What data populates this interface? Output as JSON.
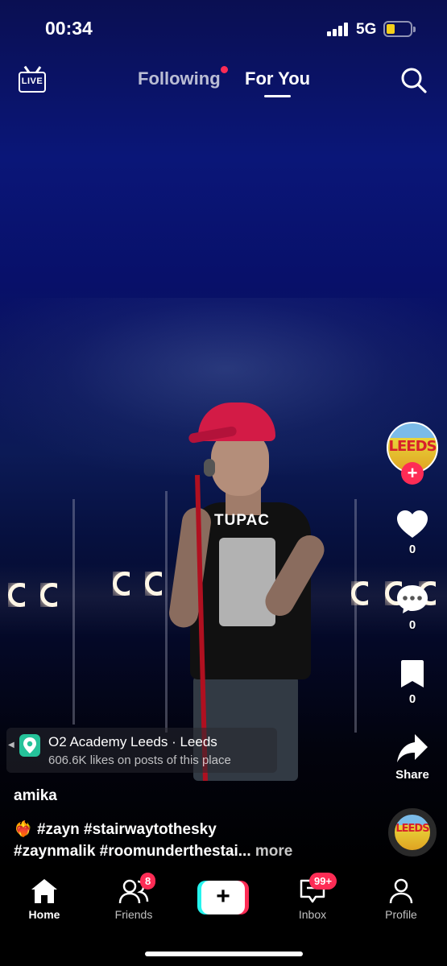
{
  "status_bar": {
    "time": "00:34",
    "network": "5G",
    "battery_level": 0.35
  },
  "top_nav": {
    "live_label": "LIVE",
    "tabs": [
      {
        "label": "Following",
        "active": false,
        "has_dot": true
      },
      {
        "label": "For You",
        "active": true
      }
    ]
  },
  "video": {
    "shirt_text": "TUPAC"
  },
  "actions": {
    "creator_avatar_text": "LEEDS",
    "likes": "0",
    "comments": "0",
    "saves": "0",
    "share_label": "Share"
  },
  "location": {
    "name": "O2 Academy Leeds · Leeds",
    "likes_text": "606.6K likes on posts of this place"
  },
  "post": {
    "username": "amika",
    "caption_emoji": "❤️‍🔥",
    "caption_line1": "#zayn #stairwaytothesky",
    "caption_line2": "#zaynmalik #roomunderthestai...",
    "more_label": "more",
    "sound_disc_text": "LEEDS"
  },
  "bottom_nav": {
    "items": [
      {
        "label": "Home",
        "icon": "home-icon",
        "active": true
      },
      {
        "label": "Friends",
        "icon": "friends-icon",
        "badge": "8"
      },
      {
        "label": "",
        "icon": "create-icon"
      },
      {
        "label": "Inbox",
        "icon": "inbox-icon",
        "badge": "99+"
      },
      {
        "label": "Profile",
        "icon": "profile-icon"
      }
    ]
  },
  "colors": {
    "accent": "#fe2c55",
    "cyan": "#25f4ee",
    "location_pin": "#25c29a"
  }
}
